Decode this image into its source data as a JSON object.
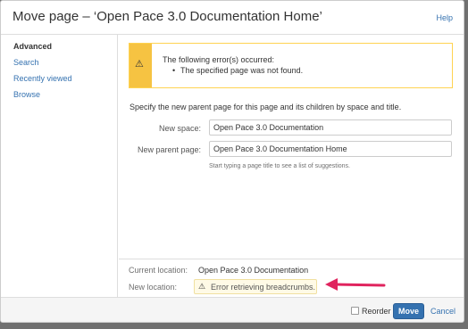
{
  "dialog": {
    "title": "Move page – ‘Open Pace 3.0 Documentation Home’",
    "help_label": "Help"
  },
  "sidebar": {
    "items": [
      {
        "label": "Advanced",
        "active": true
      },
      {
        "label": "Search",
        "active": false
      },
      {
        "label": "Recently viewed",
        "active": false
      },
      {
        "label": "Browse",
        "active": false
      }
    ]
  },
  "error": {
    "icon": "warning-icon",
    "heading": "The following error(s) occurred:",
    "message": "The specified page was not found."
  },
  "form": {
    "intro": "Specify the new parent page for this page and its children by space and title.",
    "space_label": "New space:",
    "space_value": "Open Pace 3.0 Documentation",
    "parent_label": "New parent page:",
    "parent_value": "Open Pace 3.0 Documentation Home",
    "hint": "Start typing a page title to see a list of suggestions."
  },
  "location": {
    "current_label": "Current location:",
    "current_value": "Open Pace 3.0 Documentation",
    "new_label": "New location:",
    "new_error": "Error retrieving breadcrumbs."
  },
  "footer": {
    "reorder_label": "Reorder",
    "move_label": "Move",
    "cancel_label": "Cancel"
  },
  "colors": {
    "accent": "#3572b0",
    "warning": "#f6c342",
    "annotation_arrow": "#e0245e"
  }
}
